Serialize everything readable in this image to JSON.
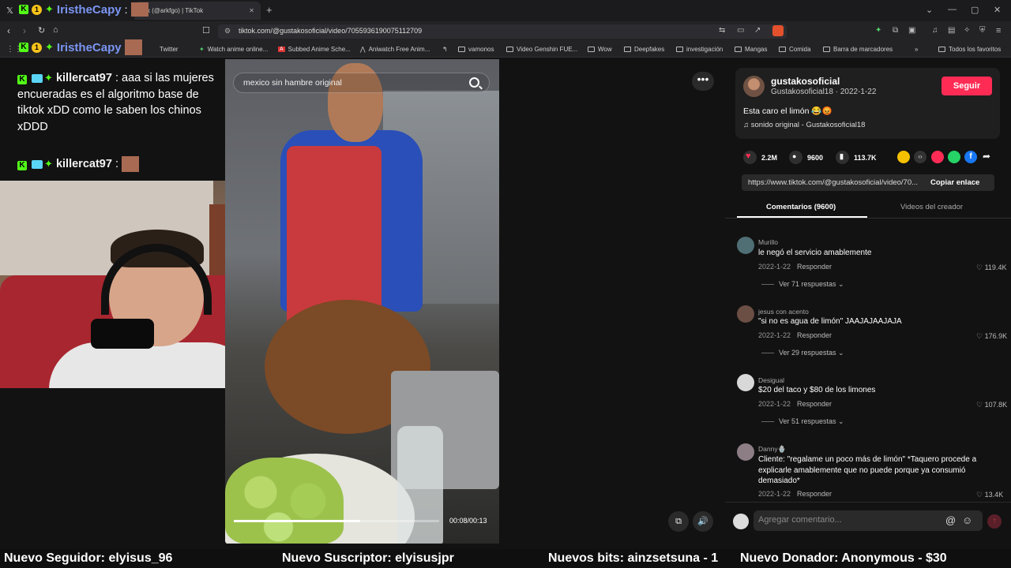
{
  "browser": {
    "active_tab_title": "Ark (@arkfgo) | TikTok",
    "url": "tiktok.com/@gustakosoficial/video/7055936190075112709",
    "bookmarks": [
      {
        "label": "Twitter",
        "type": "site"
      },
      {
        "label": "Watch anime online...",
        "type": "site"
      },
      {
        "label": "Subbed Anime Sche...",
        "type": "site"
      },
      {
        "label": "Aniwatch Free Anim...",
        "type": "site"
      },
      {
        "label": "vamonos",
        "type": "folder"
      },
      {
        "label": "Video Genshin FUE...",
        "type": "folder"
      },
      {
        "label": "Wow",
        "type": "folder"
      },
      {
        "label": "Deepfakes",
        "type": "folder"
      },
      {
        "label": "investigación",
        "type": "folder"
      },
      {
        "label": "Mangas",
        "type": "folder"
      },
      {
        "label": "Comida",
        "type": "folder"
      },
      {
        "label": "Barra de marcadores",
        "type": "folder"
      }
    ],
    "all_favorites": "Todos los favoritos"
  },
  "stream": {
    "overlay_user": "IristheCapy",
    "overlay_separator": ":",
    "chat": [
      {
        "user": "killercat97",
        "text": ": aaa si las mujeres encueradas es el algoritmo base de tiktok xDD como le saben los chinos xDDD"
      },
      {
        "user": "killercat97",
        "text": ":"
      }
    ],
    "ticker": [
      "Nuevo Seguidor: elyisus_96",
      "Nuevo Suscriptor: elyisusjpr",
      "Nuevos bits: ainzsetsuna - 1",
      "Nuevo Donador: Anonymous - $30"
    ]
  },
  "video": {
    "search_text": "mexico sin hambre original",
    "time": "00:08/00:13",
    "progress": 0.615
  },
  "creator": {
    "username": "gustakosoficial",
    "display_and_date": "Gustakosoficial18 · 2022-1-22",
    "follow_label": "Seguir",
    "caption": "Esta caro el limón 😂😡",
    "sound": "sonido original - Gustakosoficial18"
  },
  "stats": {
    "likes": "2.2M",
    "comments": "9600",
    "saves": "113.7K"
  },
  "link": {
    "url": "https://www.tiktok.com/@gustakosoficial/video/70...",
    "copy_label": "Copiar enlace"
  },
  "tabs": {
    "comments": "Comentarios (9600)",
    "creator_videos": "Videos del creador"
  },
  "comments": [
    {
      "user": "Murillo",
      "text": "le negó el servicio amablemente",
      "date": "2022-1-22",
      "reply": "Responder",
      "likes": "119.4K",
      "more": "Ver 71 respuestas ⌄"
    },
    {
      "user": "jesus con acento",
      "text": "\"si no es agua de limón\" JAAJAJAAJAJA",
      "date": "2022-1-22",
      "reply": "Responder",
      "likes": "176.9K",
      "more": "Ver 29 respuestas ⌄"
    },
    {
      "user": "Desigual",
      "text": "$20 del taco y $80 de los limones",
      "date": "2022-1-22",
      "reply": "Responder",
      "likes": "107.8K",
      "more": "Ver 51 respuestas ⌄"
    },
    {
      "user": "Danny🪬",
      "text": "Cliente: \"regalame un poco más de limón\" *Taquero procede a explicarle amablemente que no puede porque ya consumió demasiado*",
      "date": "2022-1-22",
      "reply": "Responder",
      "likes": "13.4K",
      "more": ""
    }
  ],
  "comment_input": {
    "placeholder": "Agregar comentario..."
  }
}
